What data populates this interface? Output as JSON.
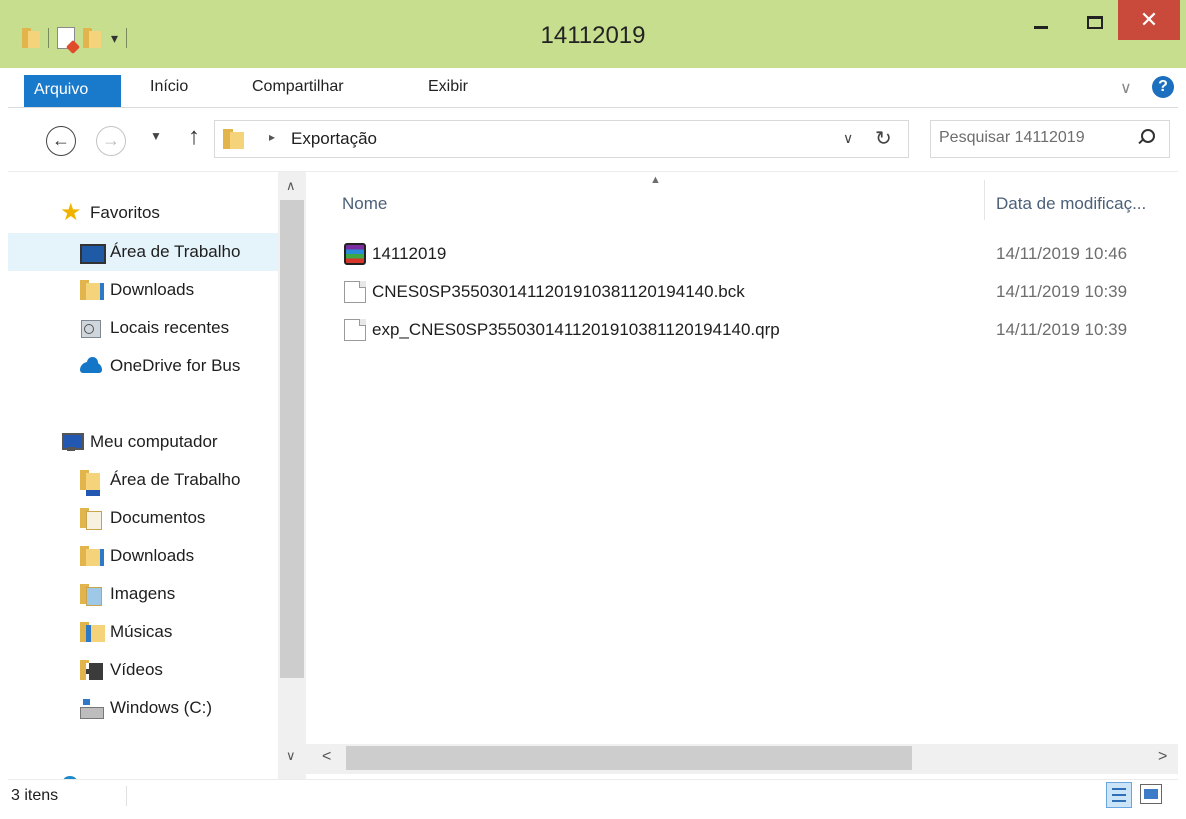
{
  "window": {
    "title": "14112019",
    "close_glyph": "✕",
    "accent_color": "#c7de8e",
    "close_color": "#c94a3b"
  },
  "quick_access": {
    "icons": [
      "folder-icon",
      "properties-icon",
      "new-folder-icon"
    ],
    "dropdown_glyph": "▾"
  },
  "ribbon": {
    "tabs": [
      "Arquivo",
      "Início",
      "Compartilhar",
      "Exibir"
    ],
    "file_tab_color": "#1979ca",
    "expand_glyph": "∨",
    "help_glyph": "?"
  },
  "navigation": {
    "back_glyph": "←",
    "forward_glyph": "→",
    "recent_glyph": "▼",
    "up_glyph": "↑",
    "breadcrumb": [
      "Exportação"
    ],
    "breadcrumb_sep": "▸",
    "dropdown_glyph": "∨",
    "refresh_glyph": "↻"
  },
  "search": {
    "placeholder": "Pesquisar 14112019",
    "value": ""
  },
  "sidebar": {
    "scroll_up": "∧",
    "scroll_down": "∨",
    "groups": [
      {
        "label": "Favoritos",
        "icon": "star-icon",
        "items": [
          {
            "label": "Área de Trabalho",
            "icon": "desktop-icon",
            "selected": true
          },
          {
            "label": "Downloads",
            "icon": "downloads-folder-icon"
          },
          {
            "label": "Locais recentes",
            "icon": "recent-places-icon"
          },
          {
            "label": "OneDrive for Bus",
            "icon": "onedrive-icon"
          }
        ]
      },
      {
        "label": "Meu computador",
        "icon": "computer-icon",
        "items": [
          {
            "label": "Área de Trabalho",
            "icon": "desktop-folder-icon"
          },
          {
            "label": "Documentos",
            "icon": "documents-folder-icon"
          },
          {
            "label": "Downloads",
            "icon": "downloads-folder-icon"
          },
          {
            "label": "Imagens",
            "icon": "pictures-folder-icon"
          },
          {
            "label": "Músicas",
            "icon": "music-folder-icon"
          },
          {
            "label": "Vídeos",
            "icon": "videos-folder-icon"
          },
          {
            "label": "Windows (C:)",
            "icon": "drive-icon"
          }
        ]
      }
    ]
  },
  "file_list": {
    "columns": [
      "Nome",
      "Data de modificaç..."
    ],
    "sort_indicator": "▲",
    "files": [
      {
        "name": "14112019",
        "date": "14/11/2019 10:46",
        "icon": "rar-archive-icon"
      },
      {
        "name": "CNES0SP3550301411201910381120194140.bck",
        "date": "14/11/2019 10:39",
        "icon": "file-icon"
      },
      {
        "name": "exp_CNES0SP3550301411201910381120194140.qrp",
        "date": "14/11/2019 10:39",
        "icon": "file-icon"
      }
    ],
    "scroll_left": "<",
    "scroll_right": ">"
  },
  "status": {
    "item_count": "3 itens",
    "view_modes": [
      "details-view-icon",
      "tiles-view-icon"
    ]
  }
}
